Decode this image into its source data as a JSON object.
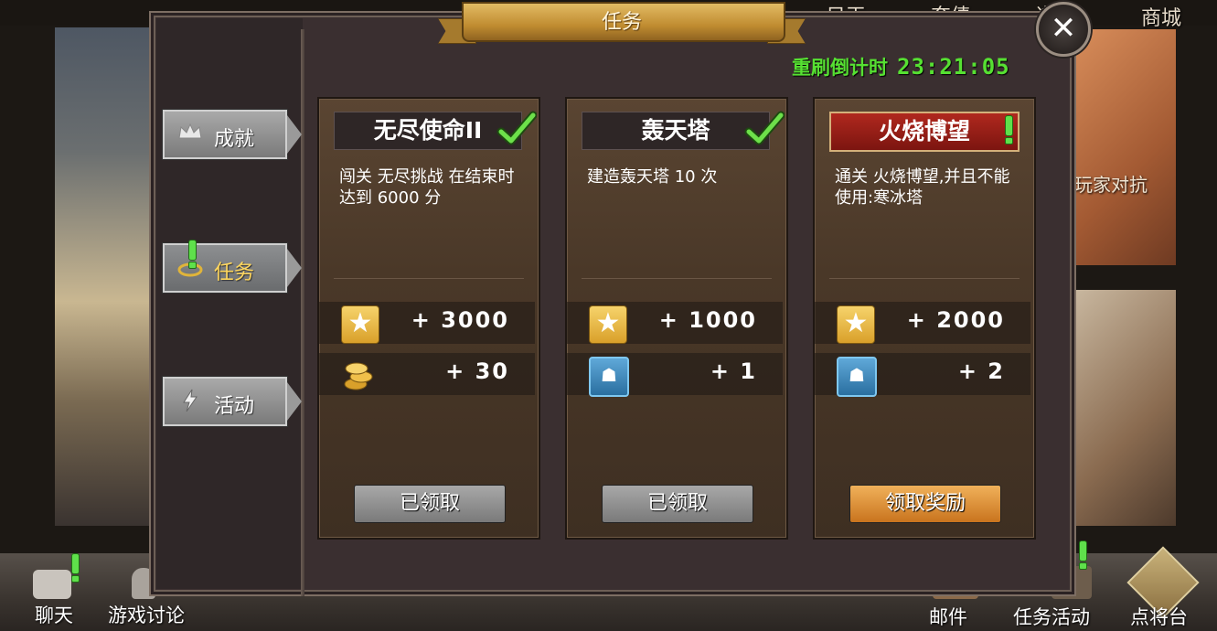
{
  "top_nav": {
    "items": [
      "日天",
      "奔债",
      "道",
      "商城"
    ]
  },
  "background": {
    "right_label": "玩家对抗"
  },
  "dialog": {
    "title": "任务",
    "refresh_label": "重刷倒计时",
    "refresh_time": "23:21:05",
    "close_icon": "close-icon"
  },
  "tabs": [
    {
      "label": "成就",
      "icon": "crown-icon",
      "active": false
    },
    {
      "label": "任务",
      "icon": "quest-icon",
      "active": true,
      "alert": true
    },
    {
      "label": "活动",
      "icon": "lightning-icon",
      "active": false
    }
  ],
  "cards": [
    {
      "title": "无尽使命II",
      "status": "completed",
      "description": "闯关 无尽挑战 在结束时达到 6000 分",
      "rewards": [
        {
          "icon": "star-icon",
          "value": "+ 3000"
        },
        {
          "icon": "coin-icon",
          "value": "+ 30"
        }
      ],
      "button": "已领取",
      "button_state": "claimed"
    },
    {
      "title": "轰天塔",
      "status": "completed",
      "description": "建造轰天塔 10 次",
      "rewards": [
        {
          "icon": "star-icon",
          "value": "+ 1000"
        },
        {
          "icon": "tiger-card-icon",
          "value": "+ 1"
        }
      ],
      "button": "已领取",
      "button_state": "claimed"
    },
    {
      "title": "火烧博望",
      "status": "alert",
      "description": "通关 火烧博望,并且不能使用:寒冰塔",
      "rewards": [
        {
          "icon": "star-icon",
          "value": "+ 2000"
        },
        {
          "icon": "tiger-card-icon",
          "value": "+ 2"
        }
      ],
      "button": "领取奖励",
      "button_state": "claimable"
    }
  ],
  "bottom_bar": {
    "chat": "聊天",
    "discussion": "游戏讨论",
    "mail": "邮件",
    "quest_activity": "任务活动",
    "general_stage": "点将台"
  },
  "colors": {
    "accent_green": "#56e032",
    "dialog_bg": "#3a2f30",
    "card_bg": "#4a3828",
    "claim_orange": "#e39a3c"
  }
}
